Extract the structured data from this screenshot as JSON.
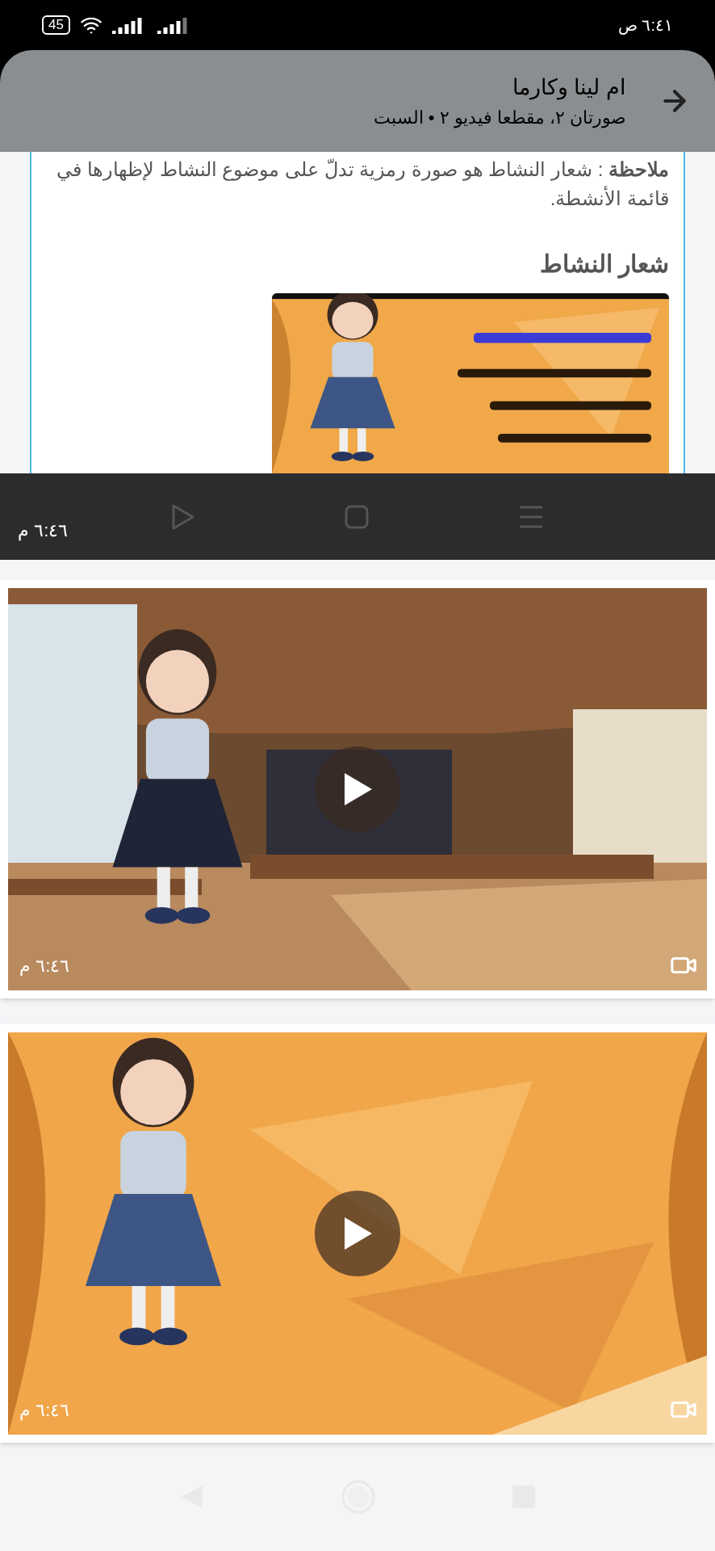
{
  "status_bar": {
    "time": "٦:٤١ ص",
    "battery": "45"
  },
  "header": {
    "title": "ام لينا وكارما",
    "subtitle": "صورتان ٢، مقطعا فيديو ٢ • السبت"
  },
  "media": [
    {
      "kind": "screenshot",
      "note": "**ملاحظة** : شعار النشاط هو صورة رمزية تدلّ على موضوع النشاط لإظهارها في قائمة الأنشطة.",
      "heading": "شعار النشاط",
      "time": "٦:٤٦ م"
    },
    {
      "kind": "video",
      "time": "٦:٤٦ م"
    },
    {
      "kind": "video",
      "time": "٦:٤٦ م"
    }
  ]
}
